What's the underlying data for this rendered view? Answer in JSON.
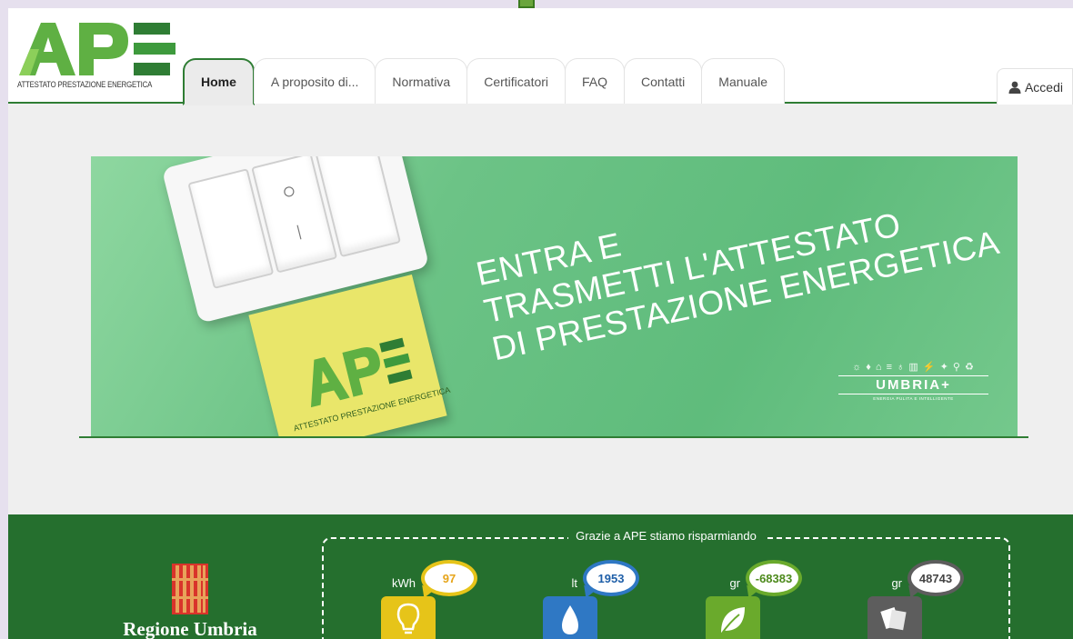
{
  "logo": {
    "text": "APE",
    "subtitle": "ATTESTATO PRESTAZIONE ENERGETICA"
  },
  "nav": {
    "tabs": [
      {
        "label": "Home",
        "active": true
      },
      {
        "label": "A proposito di...",
        "active": false
      },
      {
        "label": "Normativa",
        "active": false
      },
      {
        "label": "Certificatori",
        "active": false
      },
      {
        "label": "FAQ",
        "active": false
      },
      {
        "label": "Contatti",
        "active": false
      },
      {
        "label": "Manuale",
        "active": false
      }
    ],
    "login_label": "Accedi"
  },
  "banner": {
    "line1": "ENTRA E",
    "line2": "TRASMETTI L'ATTESTATO",
    "line3": "DI PRESTAZIONE ENERGETICA",
    "postit_logo": "APE",
    "postit_subtitle": "ATTESTATO PRESTAZIONE ENERGETICA",
    "umbria_name": "UMBRIA+",
    "umbria_tagline": "ENERGIA PULITA E INTELLIGENTE"
  },
  "footer": {
    "region_name": "Regione Umbria",
    "savings_title": "Grazie a APE stiamo risparmiando",
    "stats": [
      {
        "unit": "kWh",
        "value": "97",
        "color": "#e6c419",
        "icon": "lightbulb-icon"
      },
      {
        "unit": "lt",
        "value": "1953",
        "color": "#2f78c4",
        "icon": "water-drop-icon"
      },
      {
        "unit": "gr",
        "value": "-68383",
        "color": "#6aaa2c",
        "icon": "leaf-icon"
      },
      {
        "unit": "gr",
        "value": "48743",
        "color": "#5d5d5d",
        "icon": "paper-icon"
      }
    ]
  },
  "colors": {
    "brand_green": "#2f7d34",
    "footer_green": "#256f2e",
    "logo_green": "#7ac142"
  }
}
